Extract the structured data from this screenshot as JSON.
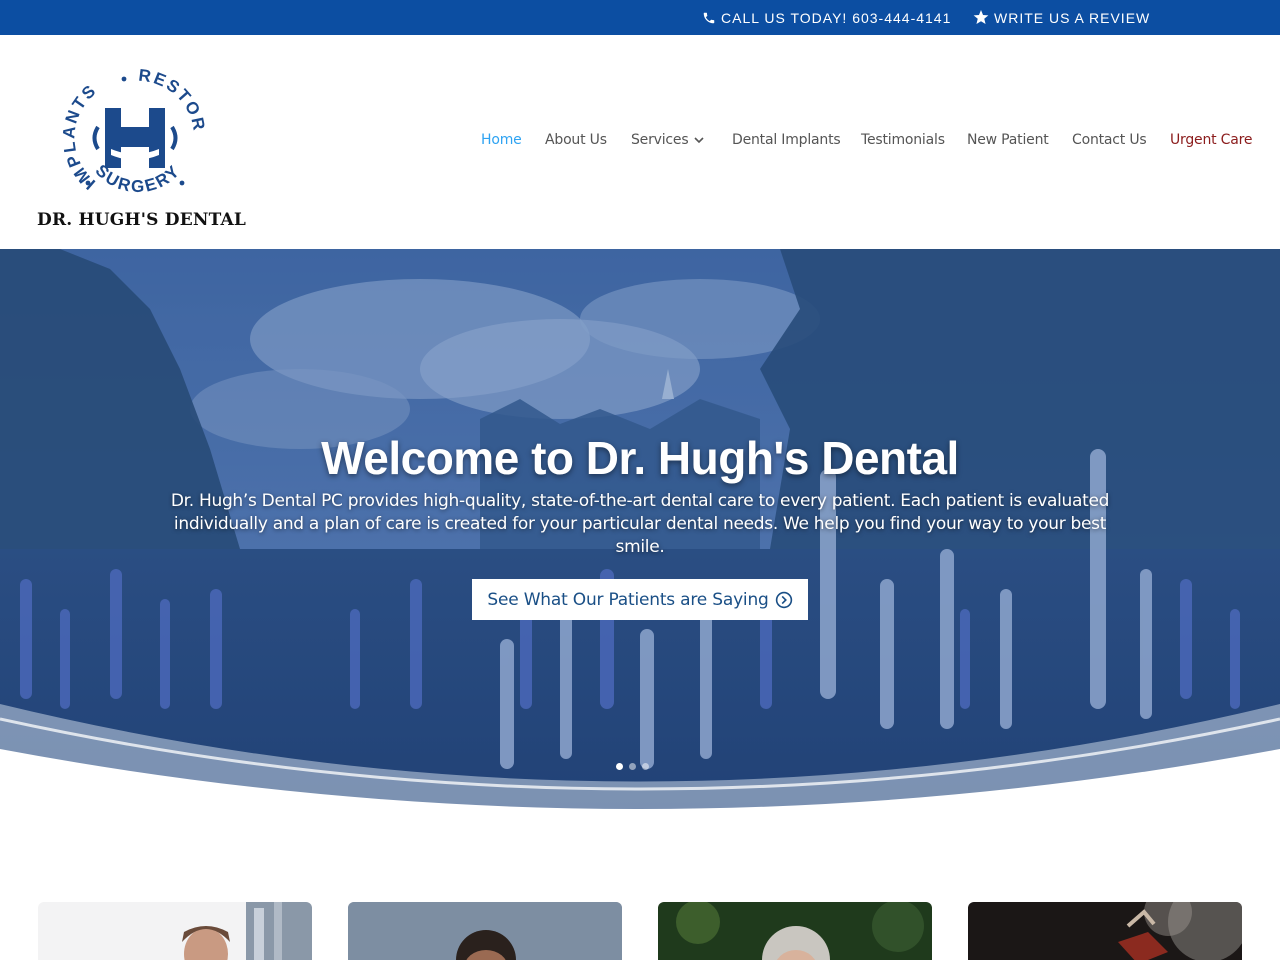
{
  "topbar": {
    "call": "CALL US TODAY! 603-444-4141",
    "review": "WRITE US A REVIEW",
    "call_icon": "phone-icon",
    "review_icon": "star-icon"
  },
  "logo": {
    "ring_top": "RESTORATIVE",
    "ring_left": "IMPLANTS",
    "ring_bottom": "SURGERY",
    "name": "DR. HUGH'S DENTAL"
  },
  "nav": {
    "items": [
      "Home",
      "About Us",
      "Services",
      "Dental Implants",
      "Testimonials",
      "New Patient",
      "Contact Us",
      "Urgent Care"
    ],
    "active": "Home"
  },
  "hero": {
    "title": "Welcome to Dr. Hugh's Dental",
    "description": "Dr. Hugh’s Dental PC provides high-quality, state-of-the-art dental care to every patient. Each patient is evaluated individually and a plan of care is created for your particular dental needs. We help you find your way to your best smile.",
    "button": "See What Our Patients are Saying",
    "slides": 3,
    "current_slide": 1
  },
  "colors": {
    "topbar": "#0c4ea2",
    "brand_blue": "#1c4a8c",
    "nav_active": "#2ea3f2",
    "urgent": "#8b1c1c"
  }
}
